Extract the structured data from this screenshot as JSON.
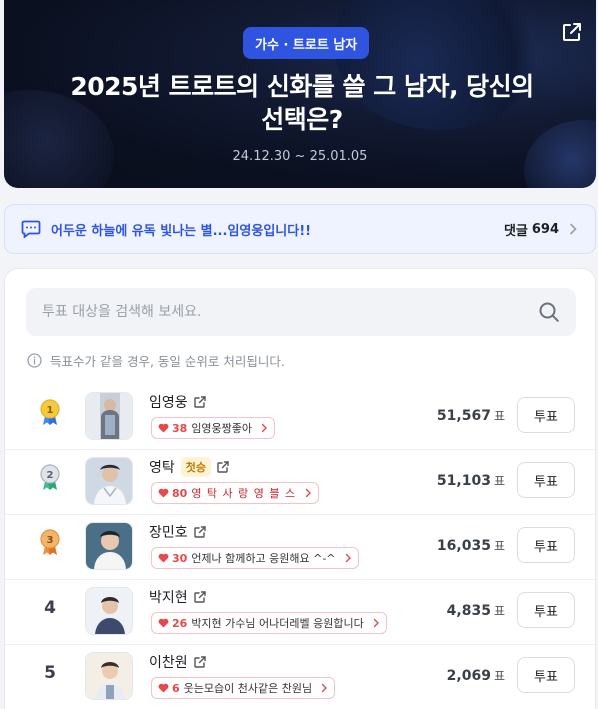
{
  "hero": {
    "category": "가수 · 트로트 남자",
    "title_line1": "2025년 트로트의 신화를 쓸 그 남자, 당신의",
    "title_line2": "선택은?",
    "date_range": "24.12.30 ~ 25.01.05"
  },
  "notice": {
    "message": "어두운 하늘에 유독 빛나는 별...임영웅입니다!!",
    "comments_label": "댓글",
    "comments_count": "694"
  },
  "search": {
    "placeholder": "투표 대상을 검색해 보세요."
  },
  "tie_note": "득표수가 같을 경우, 동일 순위로 처리됩니다.",
  "vote_unit": "표",
  "vote_label": "투표",
  "colors": {
    "accent": "#2f55e0",
    "heart": "#e5484d",
    "gold": "#e0b22b",
    "silver": "#a8b0be",
    "bronze": "#e3943a"
  },
  "candidates": [
    {
      "rank": "1",
      "name": "임영웅",
      "new_badge": "",
      "cheer_count": "38",
      "cheer_text": "임영웅짱좋아",
      "votes": "51,567",
      "medal": "gold"
    },
    {
      "rank": "2",
      "name": "영탁",
      "new_badge": "첫승",
      "cheer_count": "80",
      "cheer_text": "영 탁 사 랑 영 블 스",
      "votes": "51,103",
      "medal": "silver"
    },
    {
      "rank": "3",
      "name": "장민호",
      "new_badge": "",
      "cheer_count": "30",
      "cheer_text": "언제나 함께하고 응원해요 ^-^",
      "votes": "16,035",
      "medal": "bronze"
    },
    {
      "rank": "4",
      "name": "박지현",
      "new_badge": "",
      "cheer_count": "26",
      "cheer_text": "박지현 가수님 어나더레벨 응원합니다",
      "votes": "4,835",
      "medal": ""
    },
    {
      "rank": "5",
      "name": "이찬원",
      "new_badge": "",
      "cheer_count": "6",
      "cheer_text": "웃는모습이 천사같은 찬원님",
      "votes": "2,069",
      "medal": ""
    }
  ]
}
